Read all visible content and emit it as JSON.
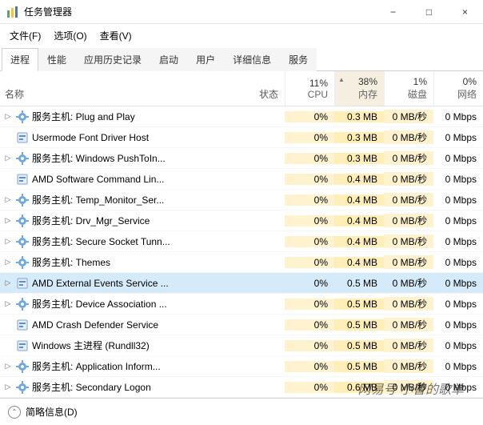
{
  "window": {
    "title": "任务管理器",
    "min_tip": "−",
    "max_tip": "□",
    "close_tip": "×"
  },
  "menu": {
    "file": "文件(F)",
    "options": "选项(O)",
    "view": "查看(V)"
  },
  "tabs": [
    {
      "id": "processes",
      "label": "进程",
      "active": true
    },
    {
      "id": "performance",
      "label": "性能",
      "active": false
    },
    {
      "id": "app_history",
      "label": "应用历史记录",
      "active": false
    },
    {
      "id": "startup",
      "label": "启动",
      "active": false
    },
    {
      "id": "users",
      "label": "用户",
      "active": false
    },
    {
      "id": "details",
      "label": "详细信息",
      "active": false
    },
    {
      "id": "services",
      "label": "服务",
      "active": false
    }
  ],
  "columns": {
    "name": "名称",
    "status": "状态",
    "cpu": {
      "pct": "11%",
      "label": "CPU"
    },
    "mem": {
      "pct": "38%",
      "label": "内存",
      "sorted": true
    },
    "disk": {
      "pct": "1%",
      "label": "磁盘"
    },
    "net": {
      "pct": "0%",
      "label": "网络"
    }
  },
  "processes": [
    {
      "exp": true,
      "icon": "gear",
      "name": "服务主机: Plug and Play",
      "cpu": "0%",
      "mem": "0.3 MB",
      "disk": "0 MB/秒",
      "net": "0 Mbps",
      "sel": false
    },
    {
      "exp": false,
      "icon": "exe",
      "name": "Usermode Font Driver Host",
      "cpu": "0%",
      "mem": "0.3 MB",
      "disk": "0 MB/秒",
      "net": "0 Mbps",
      "sel": false
    },
    {
      "exp": true,
      "icon": "gear",
      "name": "服务主机: Windows PushToIn...",
      "cpu": "0%",
      "mem": "0.3 MB",
      "disk": "0 MB/秒",
      "net": "0 Mbps",
      "sel": false
    },
    {
      "exp": false,
      "icon": "exe",
      "name": "AMD Software Command Lin...",
      "cpu": "0%",
      "mem": "0.4 MB",
      "disk": "0 MB/秒",
      "net": "0 Mbps",
      "sel": false
    },
    {
      "exp": true,
      "icon": "gear",
      "name": "服务主机: Temp_Monitor_Ser...",
      "cpu": "0%",
      "mem": "0.4 MB",
      "disk": "0 MB/秒",
      "net": "0 Mbps",
      "sel": false
    },
    {
      "exp": true,
      "icon": "gear",
      "name": "服务主机: Drv_Mgr_Service",
      "cpu": "0%",
      "mem": "0.4 MB",
      "disk": "0 MB/秒",
      "net": "0 Mbps",
      "sel": false
    },
    {
      "exp": true,
      "icon": "gear",
      "name": "服务主机: Secure Socket Tunn...",
      "cpu": "0%",
      "mem": "0.4 MB",
      "disk": "0 MB/秒",
      "net": "0 Mbps",
      "sel": false
    },
    {
      "exp": true,
      "icon": "gear",
      "name": "服务主机: Themes",
      "cpu": "0%",
      "mem": "0.4 MB",
      "disk": "0 MB/秒",
      "net": "0 Mbps",
      "sel": false
    },
    {
      "exp": true,
      "icon": "exe",
      "name": "AMD External Events Service ...",
      "cpu": "0%",
      "mem": "0.5 MB",
      "disk": "0 MB/秒",
      "net": "0 Mbps",
      "sel": true
    },
    {
      "exp": true,
      "icon": "gear",
      "name": "服务主机: Device Association ...",
      "cpu": "0%",
      "mem": "0.5 MB",
      "disk": "0 MB/秒",
      "net": "0 Mbps",
      "sel": false
    },
    {
      "exp": false,
      "icon": "exe",
      "name": "AMD Crash Defender Service",
      "cpu": "0%",
      "mem": "0.5 MB",
      "disk": "0 MB/秒",
      "net": "0 Mbps",
      "sel": false
    },
    {
      "exp": false,
      "icon": "exe",
      "name": "Windows 主进程 (Rundll32)",
      "cpu": "0%",
      "mem": "0.5 MB",
      "disk": "0 MB/秒",
      "net": "0 Mbps",
      "sel": false
    },
    {
      "exp": true,
      "icon": "gear",
      "name": "服务主机: Application Inform...",
      "cpu": "0%",
      "mem": "0.5 MB",
      "disk": "0 MB/秒",
      "net": "0 Mbps",
      "sel": false
    },
    {
      "exp": true,
      "icon": "gear",
      "name": "服务主机: Secondary Logon",
      "cpu": "0%",
      "mem": "0.6 MB",
      "disk": "0 MB/秒",
      "net": "0 Mbps",
      "sel": false
    }
  ],
  "footer": {
    "label": "简略信息(D)"
  },
  "watermark": "网易号   小曹的歌单"
}
